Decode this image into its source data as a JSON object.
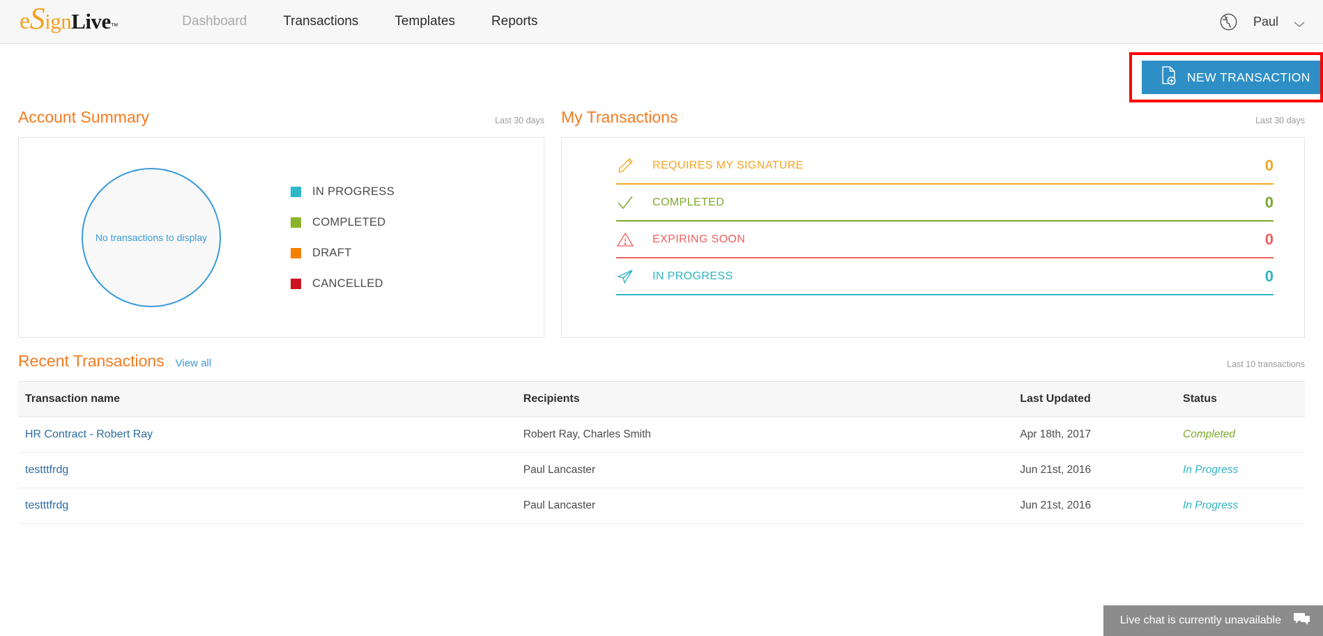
{
  "header": {
    "logo": {
      "e": "e",
      "s": "S",
      "ign": "ign",
      "live": "Live",
      "tm": "™"
    },
    "nav": [
      {
        "label": "Dashboard",
        "active": true
      },
      {
        "label": "Transactions",
        "active": false
      },
      {
        "label": "Templates",
        "active": false
      },
      {
        "label": "Reports",
        "active": false
      }
    ],
    "globe_icon": "globe-icon",
    "user": "Paul",
    "chevron_icon": "chevron-down-icon"
  },
  "action": {
    "new_transaction_label": "NEW TRANSACTION",
    "new_transaction_icon": "new-document-icon",
    "highlight_color": "#ff0000",
    "button_color": "#2e8fc6"
  },
  "account_summary": {
    "title": "Account Summary",
    "range": "Last 30 days",
    "empty_message": "No transactions to display",
    "legend": [
      {
        "label": "IN PROGRESS",
        "color": "#2eb8c6"
      },
      {
        "label": "COMPLETED",
        "color": "#8bb328"
      },
      {
        "label": "DRAFT",
        "color": "#f77f00"
      },
      {
        "label": "CANCELLED",
        "color": "#cc1122"
      }
    ]
  },
  "my_transactions": {
    "title": "My Transactions",
    "range": "Last 30 days",
    "rows": [
      {
        "label": "REQUIRES MY SIGNATURE",
        "count": "0",
        "color": "#f5a623",
        "icon": "pencil-icon"
      },
      {
        "label": "COMPLETED",
        "count": "0",
        "color": "#7ca92b",
        "icon": "check-icon"
      },
      {
        "label": "EXPIRING SOON",
        "count": "0",
        "color": "#ef5f5f",
        "icon": "warning-triangle-icon"
      },
      {
        "label": "IN PROGRESS",
        "count": "0",
        "color": "#2eb4c4",
        "icon": "paper-plane-icon"
      }
    ]
  },
  "recent_transactions": {
    "title": "Recent Transactions",
    "view_all": "View all",
    "range": "Last 10 transactions",
    "columns": [
      "Transaction name",
      "Recipients",
      "Last Updated",
      "Status"
    ],
    "rows": [
      {
        "name": "HR Contract - Robert Ray",
        "recipients": "Robert Ray, Charles Smith",
        "updated": "Apr 18th, 2017",
        "status": "Completed",
        "status_color": "#7ca92b"
      },
      {
        "name": "testttfrdg",
        "recipients": "Paul Lancaster",
        "updated": "Jun 21st, 2016",
        "status": "In Progress",
        "status_color": "#2eb4c4"
      },
      {
        "name": "testttfrdg",
        "recipients": "Paul Lancaster",
        "updated": "Jun 21st, 2016",
        "status": "In Progress",
        "status_color": "#2eb4c4"
      }
    ]
  },
  "chat": {
    "message": "Live chat is currently unavailable",
    "icon": "chat-bubble-icon"
  }
}
